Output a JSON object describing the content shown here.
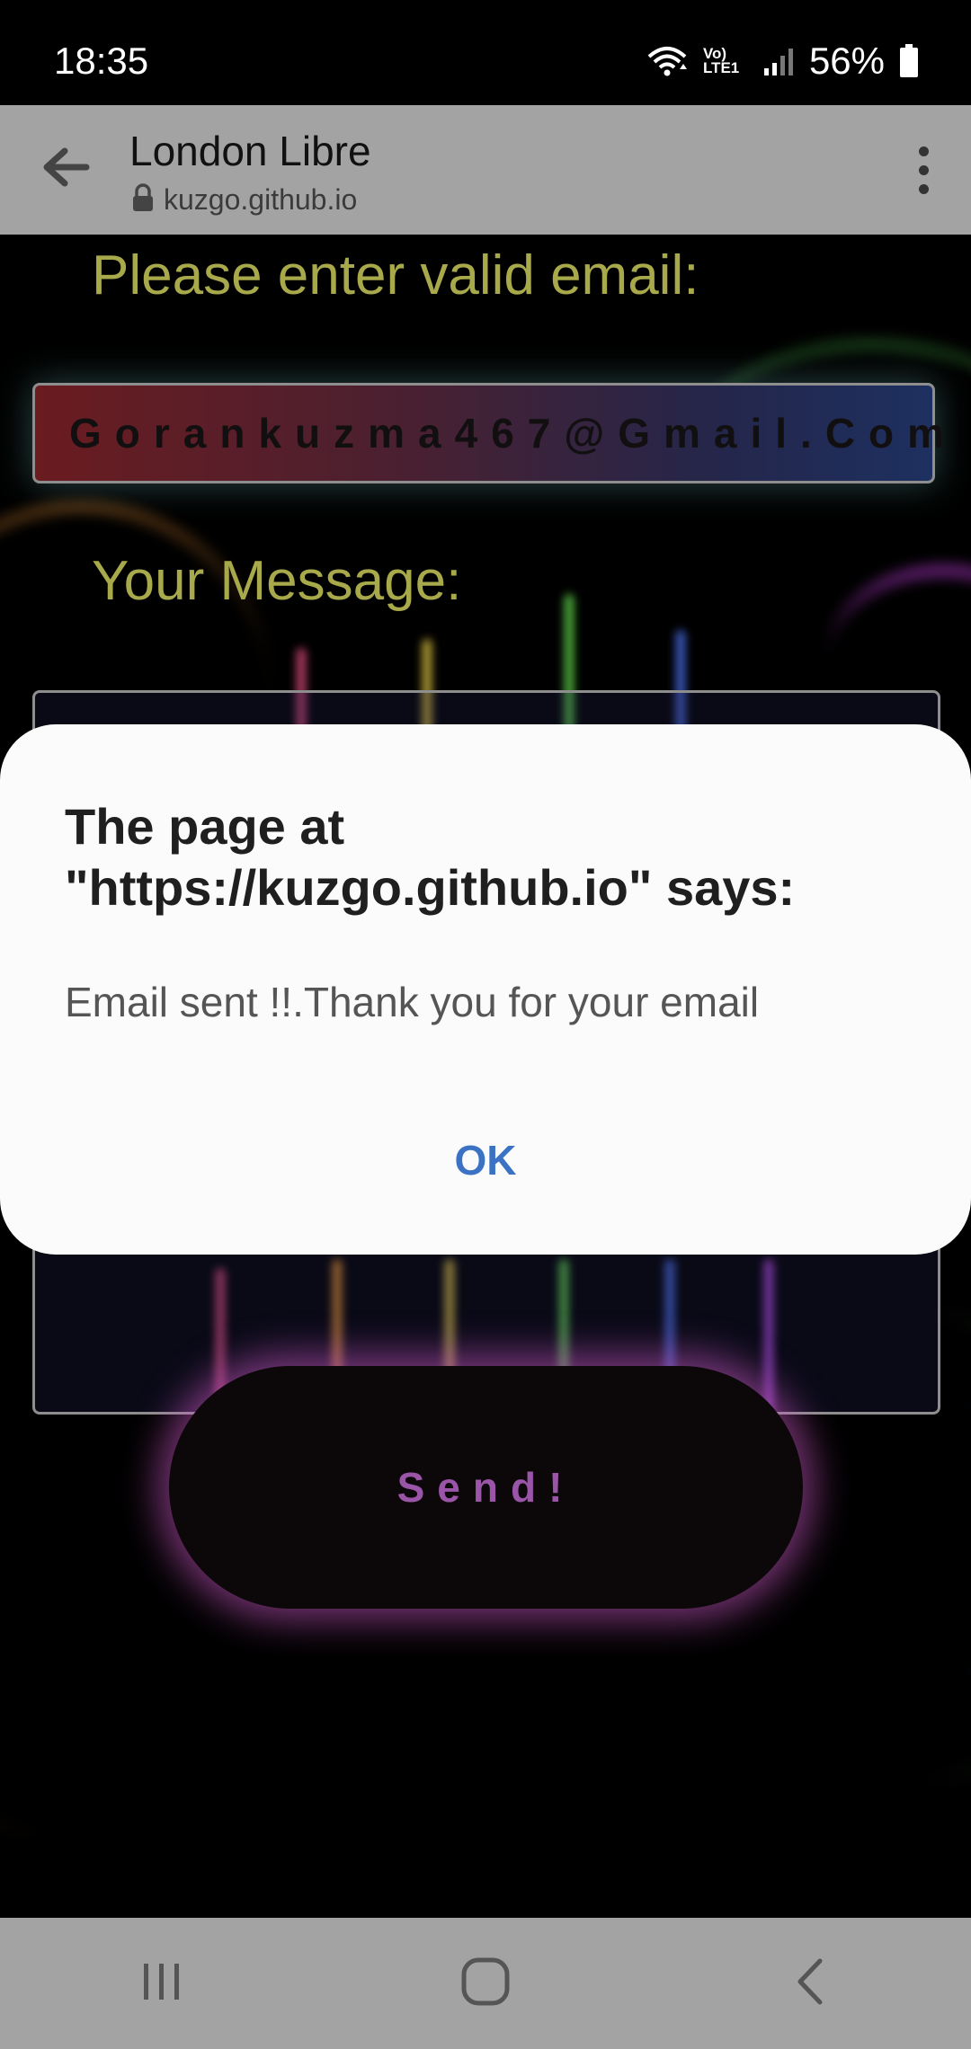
{
  "status_bar": {
    "time": "18:35",
    "battery_percent": "56%",
    "network_label": "Vo) LTE1",
    "icons": [
      "wifi-icon",
      "volte-icon",
      "signal-icon",
      "battery-icon"
    ]
  },
  "browser": {
    "title": "London Libre",
    "url": "kuzgo.github.io",
    "icons": [
      "back-arrow-icon",
      "lock-icon",
      "more-vert-icon"
    ]
  },
  "form": {
    "email_label": "Please enter valid email:",
    "email_value": "Gorankuzma467@Gmail.Com",
    "message_label": "Your Message:",
    "send_label": "Send!"
  },
  "dialog": {
    "title": "The page at \"https://kuzgo.github.io\" says:",
    "message": "Email sent !!.Thank you for your email",
    "ok_label": "OK"
  },
  "nav_bar": {
    "icons": [
      "recent-apps-icon",
      "home-icon",
      "back-icon"
    ]
  },
  "colors": {
    "label": "#a8a94a",
    "send_text": "#9a55a8",
    "ok_text": "#3b72c4",
    "toolbar_bg": "#a3a3a3"
  }
}
